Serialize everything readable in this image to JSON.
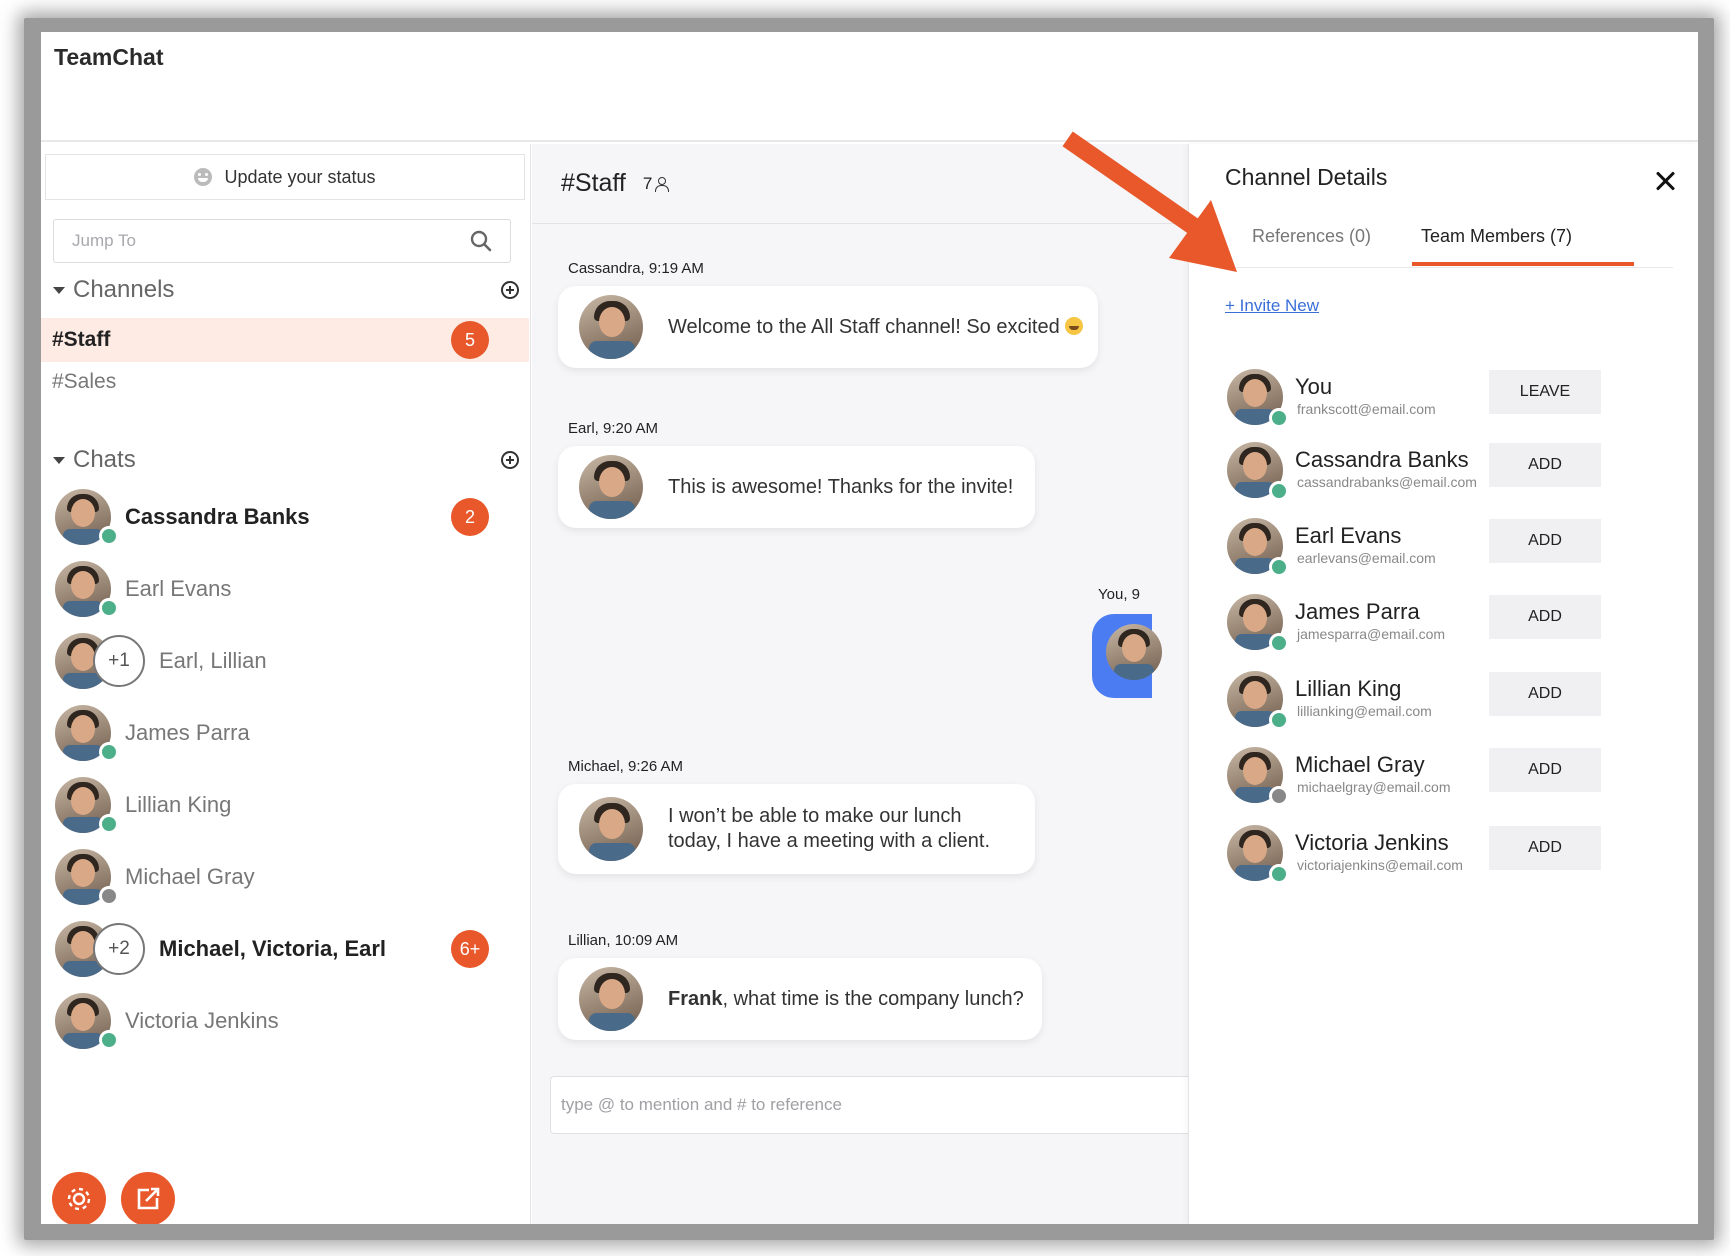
{
  "app": {
    "title": "TeamChat"
  },
  "sidebar": {
    "status_label": "Update your status",
    "jump_placeholder": "Jump To",
    "channels_title": "Channels",
    "channels": [
      {
        "name": "#Staff",
        "badge": "5",
        "active": true
      },
      {
        "name": "#Sales",
        "badge": "",
        "active": false
      }
    ],
    "chats_title": "Chats",
    "chats": [
      {
        "name": "Cassandra Banks",
        "badge": "2",
        "bold": true,
        "presence": "online",
        "extra": ""
      },
      {
        "name": "Earl Evans",
        "badge": "",
        "bold": false,
        "presence": "online",
        "extra": ""
      },
      {
        "name": "Earl, Lillian",
        "badge": "",
        "bold": false,
        "presence": "",
        "extra": "+1"
      },
      {
        "name": "James Parra",
        "badge": "",
        "bold": false,
        "presence": "online",
        "extra": ""
      },
      {
        "name": "Lillian King",
        "badge": "",
        "bold": false,
        "presence": "online",
        "extra": ""
      },
      {
        "name": "Michael Gray",
        "badge": "",
        "bold": false,
        "presence": "away",
        "extra": ""
      },
      {
        "name": "Michael, Victoria, Earl",
        "badge": "6+",
        "bold": true,
        "presence": "",
        "extra": "+2"
      },
      {
        "name": "Victoria Jenkins",
        "badge": "",
        "bold": false,
        "presence": "online",
        "extra": ""
      }
    ]
  },
  "main": {
    "channel_title": "#Staff",
    "member_count": "7",
    "messages": [
      {
        "meta": "Cassandra, 9:19 AM",
        "text": "Welcome to the All Staff channel! So excited"
      },
      {
        "meta": "Earl, 9:20 AM",
        "text": "This is awesome! Thanks for the invite!"
      },
      {
        "meta": "Michael, 9:26 AM",
        "line1": "I won’t be able to make our lunch",
        "line2": "today, I have a meeting with a client."
      },
      {
        "meta": "Lillian, 10:09 AM",
        "bold": "Frank",
        "rest": ", what time is the company lunch?"
      }
    ],
    "own_meta": "You, 9",
    "composer_placeholder": "type @ to mention and # to reference"
  },
  "details": {
    "title": "Channel Details",
    "tab_references": "References (0)",
    "tab_members": "Team Members (7)",
    "invite_label": "+ Invite New",
    "members": [
      {
        "name": "You",
        "email": "frankscott@email.com",
        "action": "LEAVE",
        "presence": "online"
      },
      {
        "name": "Cassandra Banks",
        "email": "cassandrabanks@email.com",
        "action": "ADD",
        "presence": "online"
      },
      {
        "name": "Earl Evans",
        "email": "earlevans@email.com",
        "action": "ADD",
        "presence": "online"
      },
      {
        "name": "James Parra",
        "email": "jamesparra@email.com",
        "action": "ADD",
        "presence": "online"
      },
      {
        "name": "Lillian King",
        "email": "lillianking@email.com",
        "action": "ADD",
        "presence": "online"
      },
      {
        "name": "Michael Gray",
        "email": "michaelgray@email.com",
        "action": "ADD",
        "presence": "away"
      },
      {
        "name": "Victoria Jenkins",
        "email": "victoriajenkins@email.com",
        "action": "ADD",
        "presence": "online"
      }
    ]
  },
  "colors": {
    "accent": "#e8582b",
    "online": "#4caf8a",
    "away": "#888888",
    "link": "#3a6fd8",
    "own_bubble": "#4b7cf2"
  }
}
